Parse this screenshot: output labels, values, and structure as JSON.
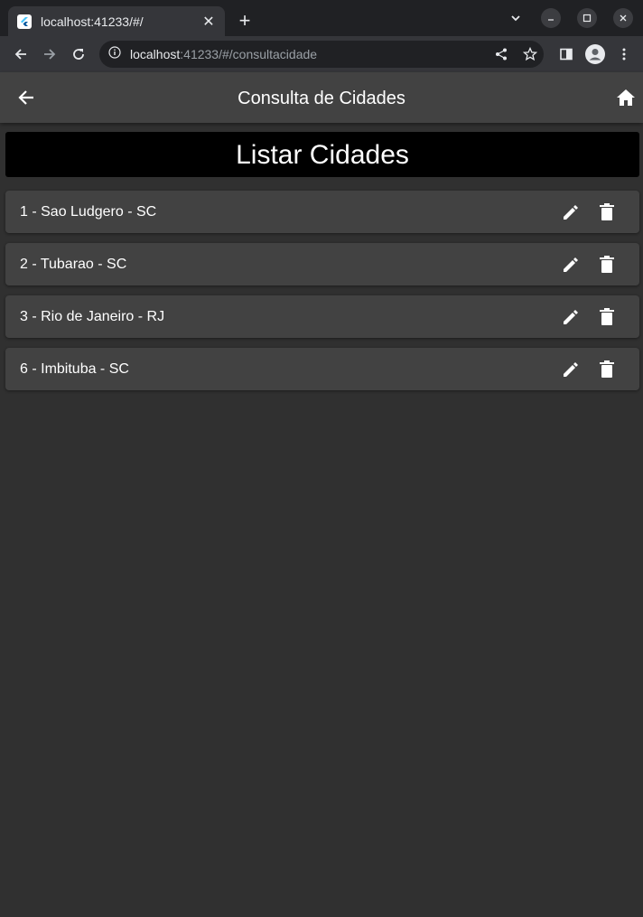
{
  "browser": {
    "tab_title": "localhost:41233/#/",
    "tab_close": "✕",
    "new_tab": "+",
    "url_host": "localhost",
    "url_rest": ":41233/#/consultacidade"
  },
  "appbar": {
    "title": "Consulta de Cidades"
  },
  "header": {
    "title": "Listar Cidades"
  },
  "cities": [
    {
      "label": "1 - Sao Ludgero - SC"
    },
    {
      "label": "2 - Tubarao - SC"
    },
    {
      "label": "3 - Rio de Janeiro - RJ"
    },
    {
      "label": "6 - Imbituba - SC"
    }
  ],
  "icons": {
    "back": "arrow-back-icon",
    "home": "home-icon",
    "edit": "pencil-icon",
    "delete": "trash-icon"
  },
  "colors": {
    "background": "#303030",
    "appbar": "#424242",
    "banner": "#000000",
    "card": "#424242",
    "text": "#ffffff"
  }
}
